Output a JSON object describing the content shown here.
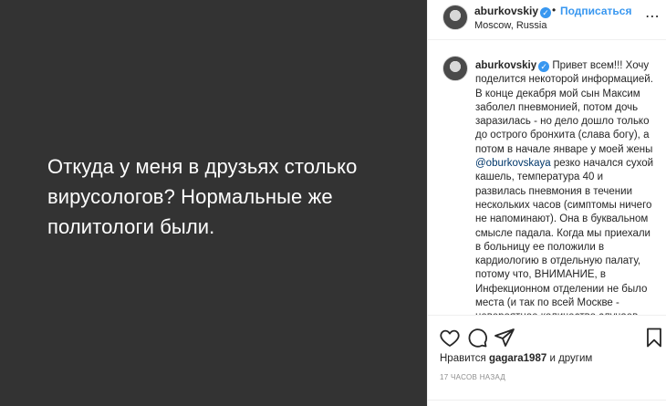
{
  "media": {
    "lines": [
      "Откуда у меня в друзьях столько",
      "вирусологов? Нормальные же",
      "политологи были."
    ]
  },
  "header": {
    "username": "aburkovskiy",
    "separator": "•",
    "follow_label": "Подписаться",
    "location": "Moscow, Russia",
    "more_icon": "⋯"
  },
  "caption": {
    "username": "aburkovskiy",
    "text_before_mention": "Привет всем!!! Хочу поделится некоторой информацией. В конце декабря мой сын Максим заболел пневмонией, потом дочь заразилась - но дело дошло только до острого бронхита (слава богу), а потом в начале январе у моей жены ",
    "mention": "@oburkovskaya",
    "text_after_mention": " резко начался сухой кашель, температура 40 и развилась пневмония в течении нескольких часов (симптомы ничего не напоминают). Она в буквальном смысле падала. Когда мы приехали в больницу ее положили в кардиологию в отдельную палату, потому что, ВНИМАНИЕ, в Инфекционном отделении не было места (и так по всей Москве - невероятное количество случаев пневмонии). Оля не вставая"
  },
  "actions": {
    "icons": [
      "heart-icon",
      "comment-icon",
      "share-icon",
      "bookmark-icon"
    ],
    "likes_prefix": "Нравится",
    "likes_user": "gagara1987",
    "likes_suffix": "и другим",
    "timestamp": "17 часов назад"
  },
  "colors": {
    "media_bg": "#333333",
    "accent": "#3897f0",
    "text": "#262626",
    "muted": "#8e8e8e"
  }
}
